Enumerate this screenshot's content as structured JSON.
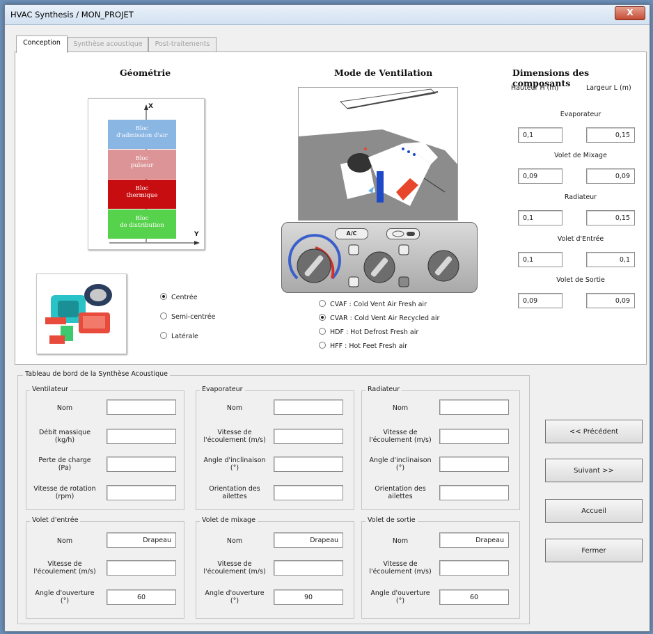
{
  "window": {
    "title": "HVAC Synthesis / MON_PROJET",
    "close_glyph": "X"
  },
  "tabs": [
    {
      "label": "Conception",
      "active": true
    },
    {
      "label": "Synthèse acoustique",
      "active": false
    },
    {
      "label": "Post-traitements",
      "active": false
    }
  ],
  "geometry": {
    "header": "Géométrie",
    "axis_x": "X",
    "axis_y": "Y",
    "blocks": [
      {
        "line1": "Bloc",
        "line2": "d'admission d'air",
        "color": "#8ab6e4"
      },
      {
        "line1": "Bloc",
        "line2": "pulseur",
        "color": "#dc9496"
      },
      {
        "line1": "Bloc",
        "line2": "thermique",
        "color": "#c80d11"
      },
      {
        "line1": "Bloc",
        "line2": "de distribution",
        "color": "#57d24c"
      }
    ],
    "position_options": [
      {
        "label": "Centrée",
        "selected": true
      },
      {
        "label": "Semi-centrée",
        "selected": false
      },
      {
        "label": "Latérale",
        "selected": false
      }
    ]
  },
  "ventilation": {
    "header": "Mode de Ventilation",
    "panel_ac_label": "A/C",
    "modes": [
      {
        "label": "CVAF : Cold Vent Air Fresh air",
        "selected": false
      },
      {
        "label": "CVAR : Cold Vent Air Recycled air",
        "selected": true
      },
      {
        "label": "HDF : Hot Defrost Fresh air",
        "selected": false
      },
      {
        "label": "HFF : Hot Feet Fresh air",
        "selected": false
      }
    ]
  },
  "dimensions": {
    "header": "Dimensions des composants",
    "col_height": "Hauteur H (m)",
    "col_width": "Largeur L (m)",
    "components": [
      {
        "name": "Evaporateur",
        "h": "0,1",
        "l": "0,15"
      },
      {
        "name": "Volet de Mixage",
        "h": "0,09",
        "l": "0,09"
      },
      {
        "name": "Radiateur",
        "h": "0,1",
        "l": "0,15"
      },
      {
        "name": "Volet d'Entrée",
        "h": "0,1",
        "l": "0,1"
      },
      {
        "name": "Volet de Sortie",
        "h": "0,09",
        "l": "0,09"
      }
    ]
  },
  "dashboard": {
    "title": "Tableau de bord de la Synthèse Acoustique",
    "ventilateur": {
      "title": "Ventilateur",
      "nom": "Nom",
      "nom_value": "",
      "debit": "Débit massique\n(kg/h)",
      "debit_value": "",
      "perte": "Perte de charge\n(Pa)",
      "perte_value": "",
      "vitesse": "Vitesse de rotation\n(rpm)",
      "vitesse_value": ""
    },
    "evaporateur": {
      "title": "Evaporateur",
      "nom": "Nom",
      "nom_value": "",
      "vitesse": "Vitesse de\nl'écoulement (m/s)",
      "vitesse_value": "",
      "angle": "Angle d'inclinaison\n(°)",
      "angle_value": "",
      "orientation": "Orientation des\nailettes",
      "orientation_value": ""
    },
    "radiateur": {
      "title": "Radiateur",
      "nom": "Nom",
      "nom_value": "",
      "vitesse": "Vitesse de\nl'écoulement (m/s)",
      "vitesse_value": "",
      "angle": "Angle d'inclinaison\n(°)",
      "angle_value": "",
      "orientation": "Orientation des\nailettes",
      "orientation_value": ""
    },
    "volet_entree": {
      "title": "Volet d'entrée",
      "nom": "Nom",
      "nom_value": "Drapeau",
      "vitesse": "Vitesse de\nl'écoulement (m/s)",
      "vitesse_value": "",
      "angle": "Angle d'ouverture\n(°)",
      "angle_value": "60"
    },
    "volet_mixage": {
      "title": "Volet de mixage",
      "nom": "Nom",
      "nom_value": "Drapeau",
      "vitesse": "Vitesse de\nl'écoulement (m/s)",
      "vitesse_value": "",
      "angle": "Angle d'ouverture\n(°)",
      "angle_value": "90"
    },
    "volet_sortie": {
      "title": "Volet de sortie",
      "nom": "Nom",
      "nom_value": "Drapeau",
      "vitesse": "Vitesse de\nl'écoulement (m/s)",
      "vitesse_value": "",
      "angle": "Angle d'ouverture\n(°)",
      "angle_value": "60"
    }
  },
  "buttons": {
    "previous": "<< Précédent",
    "next": "Suivant >>",
    "home": "Accueil",
    "close": "Fermer"
  }
}
